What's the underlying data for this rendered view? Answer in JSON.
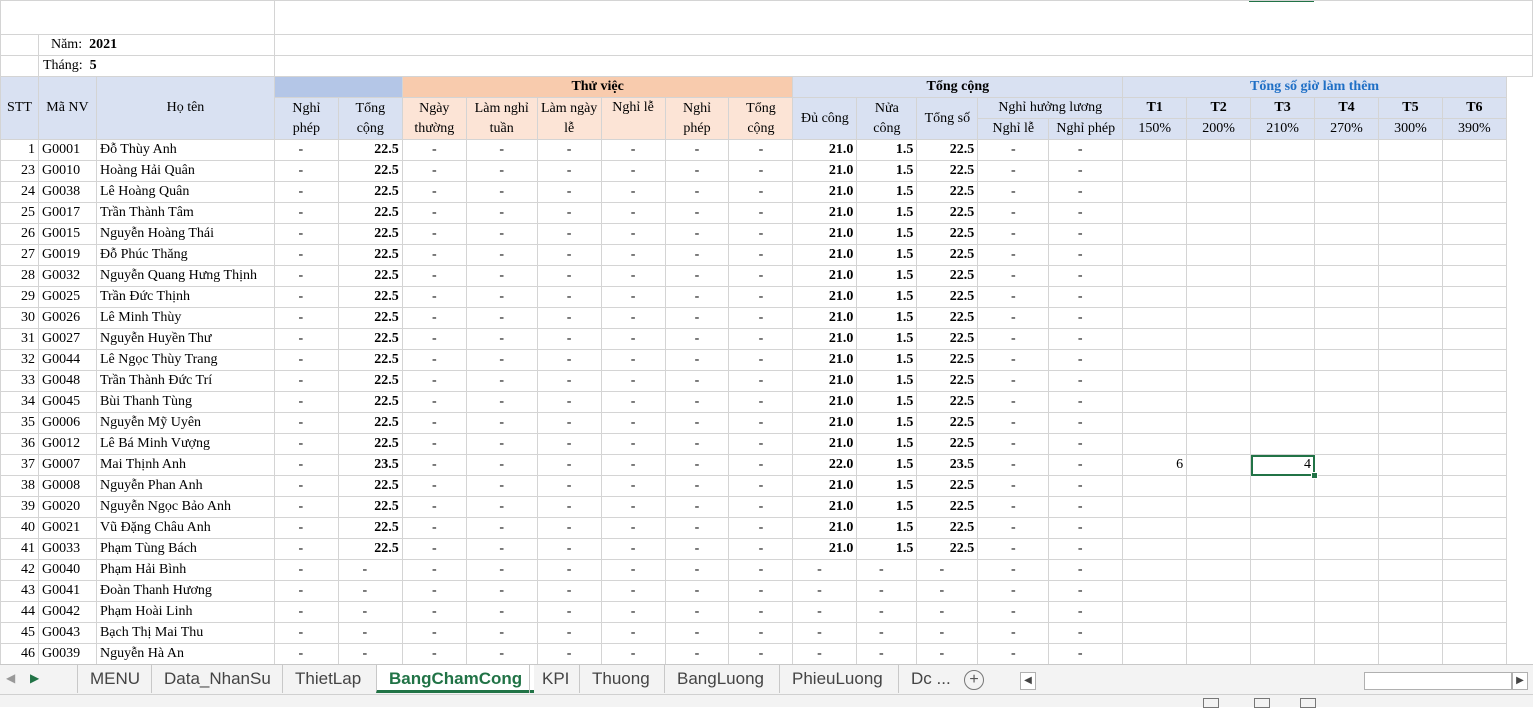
{
  "info": {
    "year_label": "Năm:",
    "year": "2021",
    "month_label": "Tháng:",
    "month": "5"
  },
  "headers": {
    "stt": "STT",
    "ma_nv": "Mã NV",
    "ho_ten": "Họ tên",
    "nghi_phep": "Nghỉ phép",
    "tong_cong": "Tổng cộng",
    "thu_viec": "Thử việc",
    "tv_ngay_thuong": "Ngày thường",
    "tv_lam_nghi_tuan": "Làm nghỉ tuần",
    "tv_lam_ngay_le": "Làm ngày lễ",
    "tv_nghi_le": "Nghỉ lễ",
    "tv_nghi_phep": "Nghỉ phép",
    "tv_tong_cong": "Tổng cộng",
    "tong_cong_group": "Tổng cộng",
    "du_cong": "Đủ công",
    "nua_cong": "Nửa công",
    "tong_so": "Tổng số",
    "nghi_huong_luong": "Nghỉ hưởng lương",
    "nhl_nghi_le": "Nghỉ lễ",
    "nhl_nghi_phep": "Nghỉ phép",
    "overtime_title": "Tổng số giờ làm thêm",
    "ot_cols": [
      {
        "name": "T1",
        "rate": "150%"
      },
      {
        "name": "T2",
        "rate": "200%"
      },
      {
        "name": "T3",
        "rate": "210%"
      },
      {
        "name": "T4",
        "rate": "270%"
      },
      {
        "name": "T5",
        "rate": "300%"
      },
      {
        "name": "T6",
        "rate": "390%"
      }
    ]
  },
  "rows": [
    {
      "stt": "1",
      "id": "G0001",
      "name": "Đỗ Thùy Anh",
      "np": "-",
      "tc": "22.5",
      "t1": "-",
      "t2": "-",
      "t3": "-",
      "t4": "-",
      "t5": "-",
      "t6": "-",
      "du": "21.0",
      "nua": "1.5",
      "ts": "22.5",
      "nl": "-",
      "npp": "-",
      "ot1": "",
      "ot3": ""
    },
    {
      "stt": "23",
      "id": "G0010",
      "name": "Hoàng Hải Quân",
      "np": "-",
      "tc": "22.5",
      "t1": "-",
      "t2": "-",
      "t3": "-",
      "t4": "-",
      "t5": "-",
      "t6": "-",
      "du": "21.0",
      "nua": "1.5",
      "ts": "22.5",
      "nl": "-",
      "npp": "-",
      "ot1": "",
      "ot3": ""
    },
    {
      "stt": "24",
      "id": "G0038",
      "name": "Lê Hoàng Quân",
      "np": "-",
      "tc": "22.5",
      "t1": "-",
      "t2": "-",
      "t3": "-",
      "t4": "-",
      "t5": "-",
      "t6": "-",
      "du": "21.0",
      "nua": "1.5",
      "ts": "22.5",
      "nl": "-",
      "npp": "-",
      "ot1": "",
      "ot3": ""
    },
    {
      "stt": "25",
      "id": "G0017",
      "name": "Trần Thành Tâm",
      "np": "-",
      "tc": "22.5",
      "t1": "-",
      "t2": "-",
      "t3": "-",
      "t4": "-",
      "t5": "-",
      "t6": "-",
      "du": "21.0",
      "nua": "1.5",
      "ts": "22.5",
      "nl": "-",
      "npp": "-",
      "ot1": "",
      "ot3": ""
    },
    {
      "stt": "26",
      "id": "G0015",
      "name": "Nguyễn Hoàng Thái",
      "np": "-",
      "tc": "22.5",
      "t1": "-",
      "t2": "-",
      "t3": "-",
      "t4": "-",
      "t5": "-",
      "t6": "-",
      "du": "21.0",
      "nua": "1.5",
      "ts": "22.5",
      "nl": "-",
      "npp": "-",
      "ot1": "",
      "ot3": ""
    },
    {
      "stt": "27",
      "id": "G0019",
      "name": "Đỗ Phúc Thăng",
      "np": "-",
      "tc": "22.5",
      "t1": "-",
      "t2": "-",
      "t3": "-",
      "t4": "-",
      "t5": "-",
      "t6": "-",
      "du": "21.0",
      "nua": "1.5",
      "ts": "22.5",
      "nl": "-",
      "npp": "-",
      "ot1": "",
      "ot3": ""
    },
    {
      "stt": "28",
      "id": "G0032",
      "name": "Nguyễn Quang Hưng Thịnh",
      "np": "-",
      "tc": "22.5",
      "t1": "-",
      "t2": "-",
      "t3": "-",
      "t4": "-",
      "t5": "-",
      "t6": "-",
      "du": "21.0",
      "nua": "1.5",
      "ts": "22.5",
      "nl": "-",
      "npp": "-",
      "ot1": "",
      "ot3": ""
    },
    {
      "stt": "29",
      "id": "G0025",
      "name": "Trần Đức Thịnh",
      "np": "-",
      "tc": "22.5",
      "t1": "-",
      "t2": "-",
      "t3": "-",
      "t4": "-",
      "t5": "-",
      "t6": "-",
      "du": "21.0",
      "nua": "1.5",
      "ts": "22.5",
      "nl": "-",
      "npp": "-",
      "ot1": "",
      "ot3": ""
    },
    {
      "stt": "30",
      "id": "G0026",
      "name": "Lê Minh Thùy",
      "np": "-",
      "tc": "22.5",
      "t1": "-",
      "t2": "-",
      "t3": "-",
      "t4": "-",
      "t5": "-",
      "t6": "-",
      "du": "21.0",
      "nua": "1.5",
      "ts": "22.5",
      "nl": "-",
      "npp": "-",
      "ot1": "",
      "ot3": ""
    },
    {
      "stt": "31",
      "id": "G0027",
      "name": "Nguyễn Huyền Thư",
      "np": "-",
      "tc": "22.5",
      "t1": "-",
      "t2": "-",
      "t3": "-",
      "t4": "-",
      "t5": "-",
      "t6": "-",
      "du": "21.0",
      "nua": "1.5",
      "ts": "22.5",
      "nl": "-",
      "npp": "-",
      "ot1": "",
      "ot3": ""
    },
    {
      "stt": "32",
      "id": "G0044",
      "name": "Lê Ngọc Thùy Trang",
      "np": "-",
      "tc": "22.5",
      "t1": "-",
      "t2": "-",
      "t3": "-",
      "t4": "-",
      "t5": "-",
      "t6": "-",
      "du": "21.0",
      "nua": "1.5",
      "ts": "22.5",
      "nl": "-",
      "npp": "-",
      "ot1": "",
      "ot3": ""
    },
    {
      "stt": "33",
      "id": "G0048",
      "name": "Trần Thành Đức Trí",
      "np": "-",
      "tc": "22.5",
      "t1": "-",
      "t2": "-",
      "t3": "-",
      "t4": "-",
      "t5": "-",
      "t6": "-",
      "du": "21.0",
      "nua": "1.5",
      "ts": "22.5",
      "nl": "-",
      "npp": "-",
      "ot1": "",
      "ot3": ""
    },
    {
      "stt": "34",
      "id": "G0045",
      "name": "Bùi Thanh Tùng",
      "np": "-",
      "tc": "22.5",
      "t1": "-",
      "t2": "-",
      "t3": "-",
      "t4": "-",
      "t5": "-",
      "t6": "-",
      "du": "21.0",
      "nua": "1.5",
      "ts": "22.5",
      "nl": "-",
      "npp": "-",
      "ot1": "",
      "ot3": ""
    },
    {
      "stt": "35",
      "id": "G0006",
      "name": "Nguyễn Mỹ Uyên",
      "np": "-",
      "tc": "22.5",
      "t1": "-",
      "t2": "-",
      "t3": "-",
      "t4": "-",
      "t5": "-",
      "t6": "-",
      "du": "21.0",
      "nua": "1.5",
      "ts": "22.5",
      "nl": "-",
      "npp": "-",
      "ot1": "",
      "ot3": ""
    },
    {
      "stt": "36",
      "id": "G0012",
      "name": "Lê Bá Minh Vượng",
      "np": "-",
      "tc": "22.5",
      "t1": "-",
      "t2": "-",
      "t3": "-",
      "t4": "-",
      "t5": "-",
      "t6": "-",
      "du": "21.0",
      "nua": "1.5",
      "ts": "22.5",
      "nl": "-",
      "npp": "-",
      "ot1": "",
      "ot3": ""
    },
    {
      "stt": "37",
      "id": "G0007",
      "name": "Mai Thịnh Anh",
      "np": "-",
      "tc": "23.5",
      "t1": "-",
      "t2": "-",
      "t3": "-",
      "t4": "-",
      "t5": "-",
      "t6": "-",
      "du": "22.0",
      "nua": "1.5",
      "ts": "23.5",
      "nl": "-",
      "npp": "-",
      "ot1": "6",
      "ot3": "4"
    },
    {
      "stt": "38",
      "id": "G0008",
      "name": "Nguyễn Phan Anh",
      "np": "-",
      "tc": "22.5",
      "t1": "-",
      "t2": "-",
      "t3": "-",
      "t4": "-",
      "t5": "-",
      "t6": "-",
      "du": "21.0",
      "nua": "1.5",
      "ts": "22.5",
      "nl": "-",
      "npp": "-",
      "ot1": "",
      "ot3": ""
    },
    {
      "stt": "39",
      "id": "G0020",
      "name": "Nguyễn Ngọc Bảo Anh",
      "np": "-",
      "tc": "22.5",
      "t1": "-",
      "t2": "-",
      "t3": "-",
      "t4": "-",
      "t5": "-",
      "t6": "-",
      "du": "21.0",
      "nua": "1.5",
      "ts": "22.5",
      "nl": "-",
      "npp": "-",
      "ot1": "",
      "ot3": ""
    },
    {
      "stt": "40",
      "id": "G0021",
      "name": "Vũ Đặng Châu Anh",
      "np": "-",
      "tc": "22.5",
      "t1": "-",
      "t2": "-",
      "t3": "-",
      "t4": "-",
      "t5": "-",
      "t6": "-",
      "du": "21.0",
      "nua": "1.5",
      "ts": "22.5",
      "nl": "-",
      "npp": "-",
      "ot1": "",
      "ot3": ""
    },
    {
      "stt": "41",
      "id": "G0033",
      "name": "Phạm Tùng Bách",
      "np": "-",
      "tc": "22.5",
      "t1": "-",
      "t2": "-",
      "t3": "-",
      "t4": "-",
      "t5": "-",
      "t6": "-",
      "du": "21.0",
      "nua": "1.5",
      "ts": "22.5",
      "nl": "-",
      "npp": "-",
      "ot1": "",
      "ot3": ""
    },
    {
      "stt": "42",
      "id": "G0040",
      "name": "Phạm Hải Bình",
      "np": "-",
      "tc": "-",
      "t1": "-",
      "t2": "-",
      "t3": "-",
      "t4": "-",
      "t5": "-",
      "t6": "-",
      "du": "-",
      "nua": "-",
      "ts": "-",
      "nl": "-",
      "npp": "-",
      "ot1": "",
      "ot3": ""
    },
    {
      "stt": "43",
      "id": "G0041",
      "name": "Đoàn Thanh Hương",
      "np": "-",
      "tc": "-",
      "t1": "-",
      "t2": "-",
      "t3": "-",
      "t4": "-",
      "t5": "-",
      "t6": "-",
      "du": "-",
      "nua": "-",
      "ts": "-",
      "nl": "-",
      "npp": "-",
      "ot1": "",
      "ot3": ""
    },
    {
      "stt": "44",
      "id": "G0042",
      "name": "Phạm Hoài Linh",
      "np": "-",
      "tc": "-",
      "t1": "-",
      "t2": "-",
      "t3": "-",
      "t4": "-",
      "t5": "-",
      "t6": "-",
      "du": "-",
      "nua": "-",
      "ts": "-",
      "nl": "-",
      "npp": "-",
      "ot1": "",
      "ot3": ""
    },
    {
      "stt": "45",
      "id": "G0043",
      "name": "Bạch Thị Mai Thu",
      "np": "-",
      "tc": "-",
      "t1": "-",
      "t2": "-",
      "t3": "-",
      "t4": "-",
      "t5": "-",
      "t6": "-",
      "du": "-",
      "nua": "-",
      "ts": "-",
      "nl": "-",
      "npp": "-",
      "ot1": "",
      "ot3": ""
    },
    {
      "stt": "46",
      "id": "G0039",
      "name": "Nguyễn Hà An",
      "np": "-",
      "tc": "-",
      "t1": "-",
      "t2": "-",
      "t3": "-",
      "t4": "-",
      "t5": "-",
      "t6": "-",
      "du": "-",
      "nua": "-",
      "ts": "-",
      "nl": "-",
      "npp": "-",
      "ot1": "",
      "ot3": ""
    }
  ],
  "tabs": [
    "MENU",
    "Data_NhanSu",
    "ThietLap",
    "BangChamCong",
    "KPI",
    "Thuong",
    "BangLuong",
    "PhieuLuong",
    "Dc ..."
  ],
  "active_tab": "BangChamCong",
  "colors": {
    "blue_header": "#d9e1f2",
    "peach_header": "#fce4d6",
    "overtime_title": "#1f6fc5",
    "excel_green": "#217346"
  }
}
